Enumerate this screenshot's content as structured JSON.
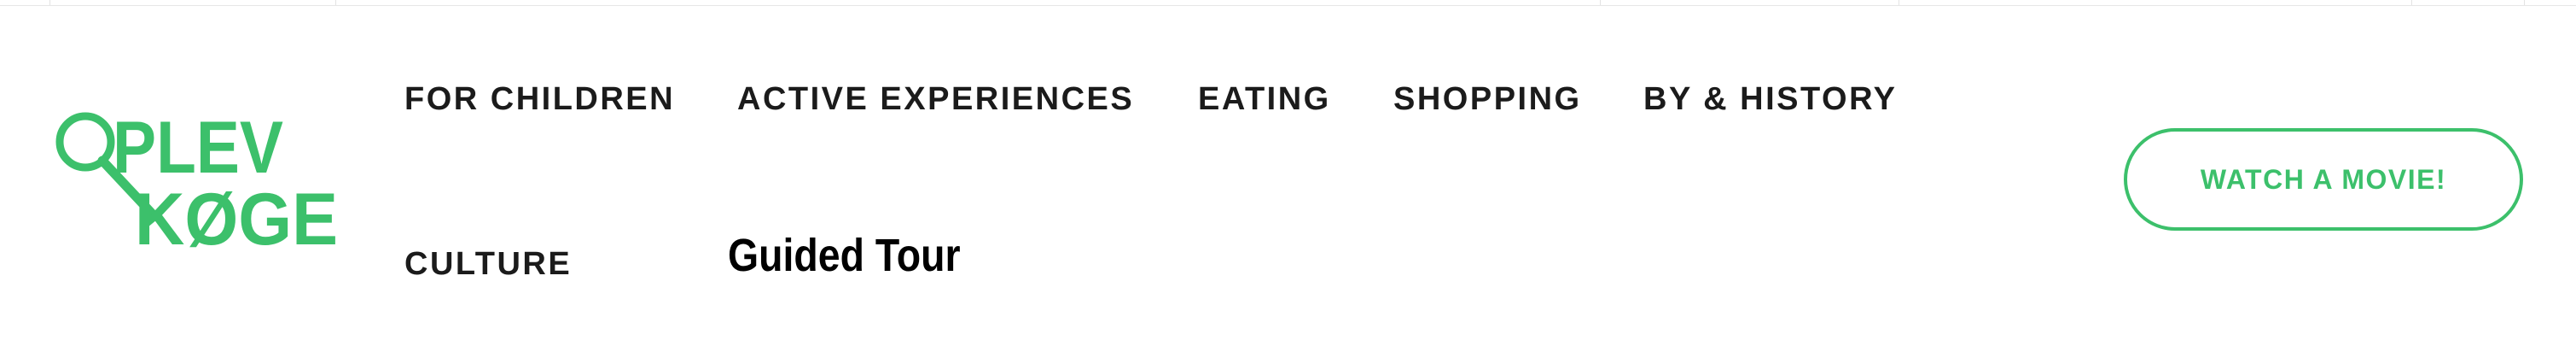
{
  "colors": {
    "brand_green": "#3cc06b",
    "nav_text": "#1b1b1b",
    "title_text": "#000000",
    "background": "#ffffff"
  },
  "logo": {
    "line1": "PLEV",
    "line2": "KØGE",
    "icon": "magnifying-glass-icon"
  },
  "nav": {
    "items": [
      {
        "label": "FOR CHILDREN"
      },
      {
        "label": "ACTIVE EXPERIENCES"
      },
      {
        "label": "EATING"
      },
      {
        "label": "SHOPPING"
      },
      {
        "label": "BY & HISTORY"
      },
      {
        "label": "CULTURE"
      }
    ]
  },
  "page": {
    "title": "Guided Tour"
  },
  "cta": {
    "label": "WATCH A MOVIE!"
  }
}
